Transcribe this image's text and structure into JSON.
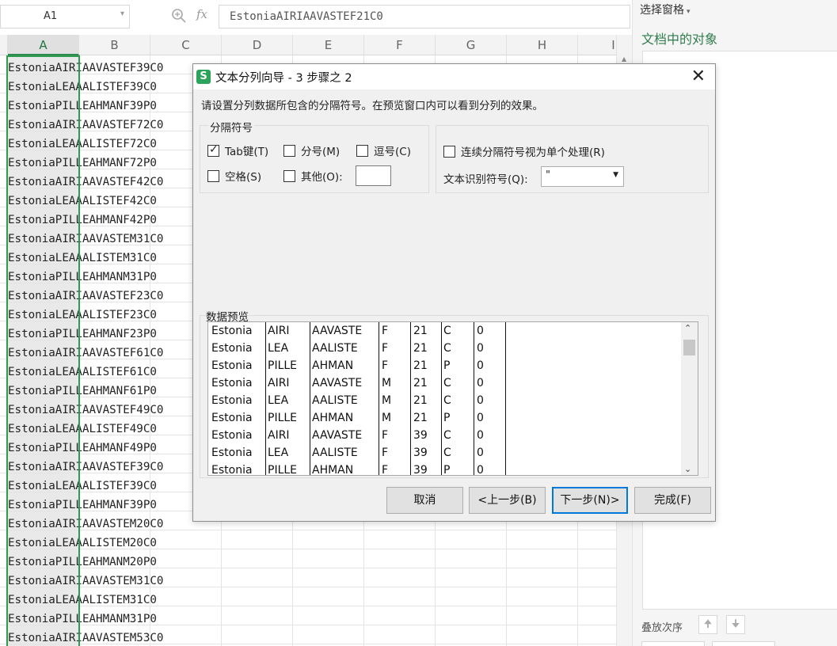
{
  "formula_bar": {
    "cell_ref": "A1",
    "fx_label": "fx",
    "formula_value": "EstoniaAIRIAAVASTEF21C0"
  },
  "sheet": {
    "columns": [
      "A",
      "B",
      "C",
      "D",
      "E",
      "F",
      "G",
      "H",
      "I"
    ],
    "selected_column": "A",
    "rows": [
      "EstoniaAIRIAAVASTEF39C0",
      "EstoniaLEAAALISTEF39C0",
      "EstoniaPILLEAHMANF39P0",
      "EstoniaAIRIAAVASTEF72C0",
      "EstoniaLEAAALISTEF72C0",
      "EstoniaPILLEAHMANF72P0",
      "EstoniaAIRIAAVASTEF42C0",
      "EstoniaLEAAALISTEF42C0",
      "EstoniaPILLEAHMANF42P0",
      "EstoniaAIRIAAVASTEM31C0",
      "EstoniaLEAAALISTEM31C0",
      "EstoniaPILLEAHMANM31P0",
      "EstoniaAIRIAAVASTEF23C0",
      "EstoniaLEAAALISTEF23C0",
      "EstoniaPILLEAHMANF23P0",
      "EstoniaAIRIAAVASTEF61C0",
      "EstoniaLEAAALISTEF61C0",
      "EstoniaPILLEAHMANF61P0",
      "EstoniaAIRIAAVASTEF49C0",
      "EstoniaLEAAALISTEF49C0",
      "EstoniaPILLEAHMANF49P0",
      "EstoniaAIRIAAVASTEF39C0",
      "EstoniaLEAAALISTEF39C0",
      "EstoniaPILLEAHMANF39P0",
      "EstoniaAIRIAAVASTEM20C0",
      "EstoniaLEAAALISTEM20C0",
      "EstoniaPILLEAHMANM20P0",
      "EstoniaAIRIAAVASTEM31C0",
      "EstoniaLEAAALISTEM31C0",
      "EstoniaPILLEAHMANM31P0",
      "EstoniaAIRIAAVASTEM53C0"
    ]
  },
  "pane": {
    "title": "选择窗格",
    "objects_heading": "文档中的对象",
    "order_label": "叠放次序",
    "up_icon": "arrow-up-icon",
    "down_icon": "arrow-down-icon"
  },
  "dialog": {
    "title": "文本分列向导 - 3 步骤之 2",
    "logo_letter": "S",
    "instruction": "请设置分列数据所包含的分隔符号。在预览窗口内可以看到分列的效果。",
    "delimiters_label": "分隔符号",
    "options": {
      "tab": {
        "label": "Tab键(T)",
        "checked": true
      },
      "semicolon": {
        "label": "分号(M)",
        "checked": false
      },
      "comma": {
        "label": "逗号(C)",
        "checked": false
      },
      "space": {
        "label": "空格(S)",
        "checked": false
      },
      "other": {
        "label": "其他(O):",
        "checked": false,
        "value": ""
      },
      "consecutive": {
        "label": "连续分隔符号视为单个处理(R)",
        "checked": false
      }
    },
    "text_qualifier_label": "文本识别符号(Q):",
    "text_qualifier_value": "\"",
    "preview_label": "数据预览",
    "preview_rows": [
      [
        "Estonia",
        "AIRI",
        "AAVASTE",
        "F",
        "21",
        "C",
        "0"
      ],
      [
        "Estonia",
        "LEA",
        "AALISTE",
        "F",
        "21",
        "C",
        "0"
      ],
      [
        "Estonia",
        "PILLE",
        "AHMAN",
        "F",
        "21",
        "P",
        "0"
      ],
      [
        "Estonia",
        "AIRI",
        "AAVASTE",
        "M",
        "21",
        "C",
        "0"
      ],
      [
        "Estonia",
        "LEA",
        "AALISTE",
        "M",
        "21",
        "C",
        "0"
      ],
      [
        "Estonia",
        "PILLE",
        "AHMAN",
        "M",
        "21",
        "P",
        "0"
      ],
      [
        "Estonia",
        "AIRI",
        "AAVASTE",
        "F",
        "39",
        "C",
        "0"
      ],
      [
        "Estonia",
        "LEA",
        "AALISTE",
        "F",
        "39",
        "C",
        "0"
      ],
      [
        "Estonia",
        "PILLE",
        "AHMAN",
        "F",
        "39",
        "P",
        "0"
      ]
    ],
    "buttons": {
      "cancel": "取消",
      "back": "<上一步(B)",
      "next": "下一步(N)>",
      "finish": "完成(F)"
    }
  },
  "colors": {
    "accent_green": "#2f9a4f",
    "pane_heading_green": "#2f7d4c",
    "primary_button_border": "#0078d7"
  }
}
